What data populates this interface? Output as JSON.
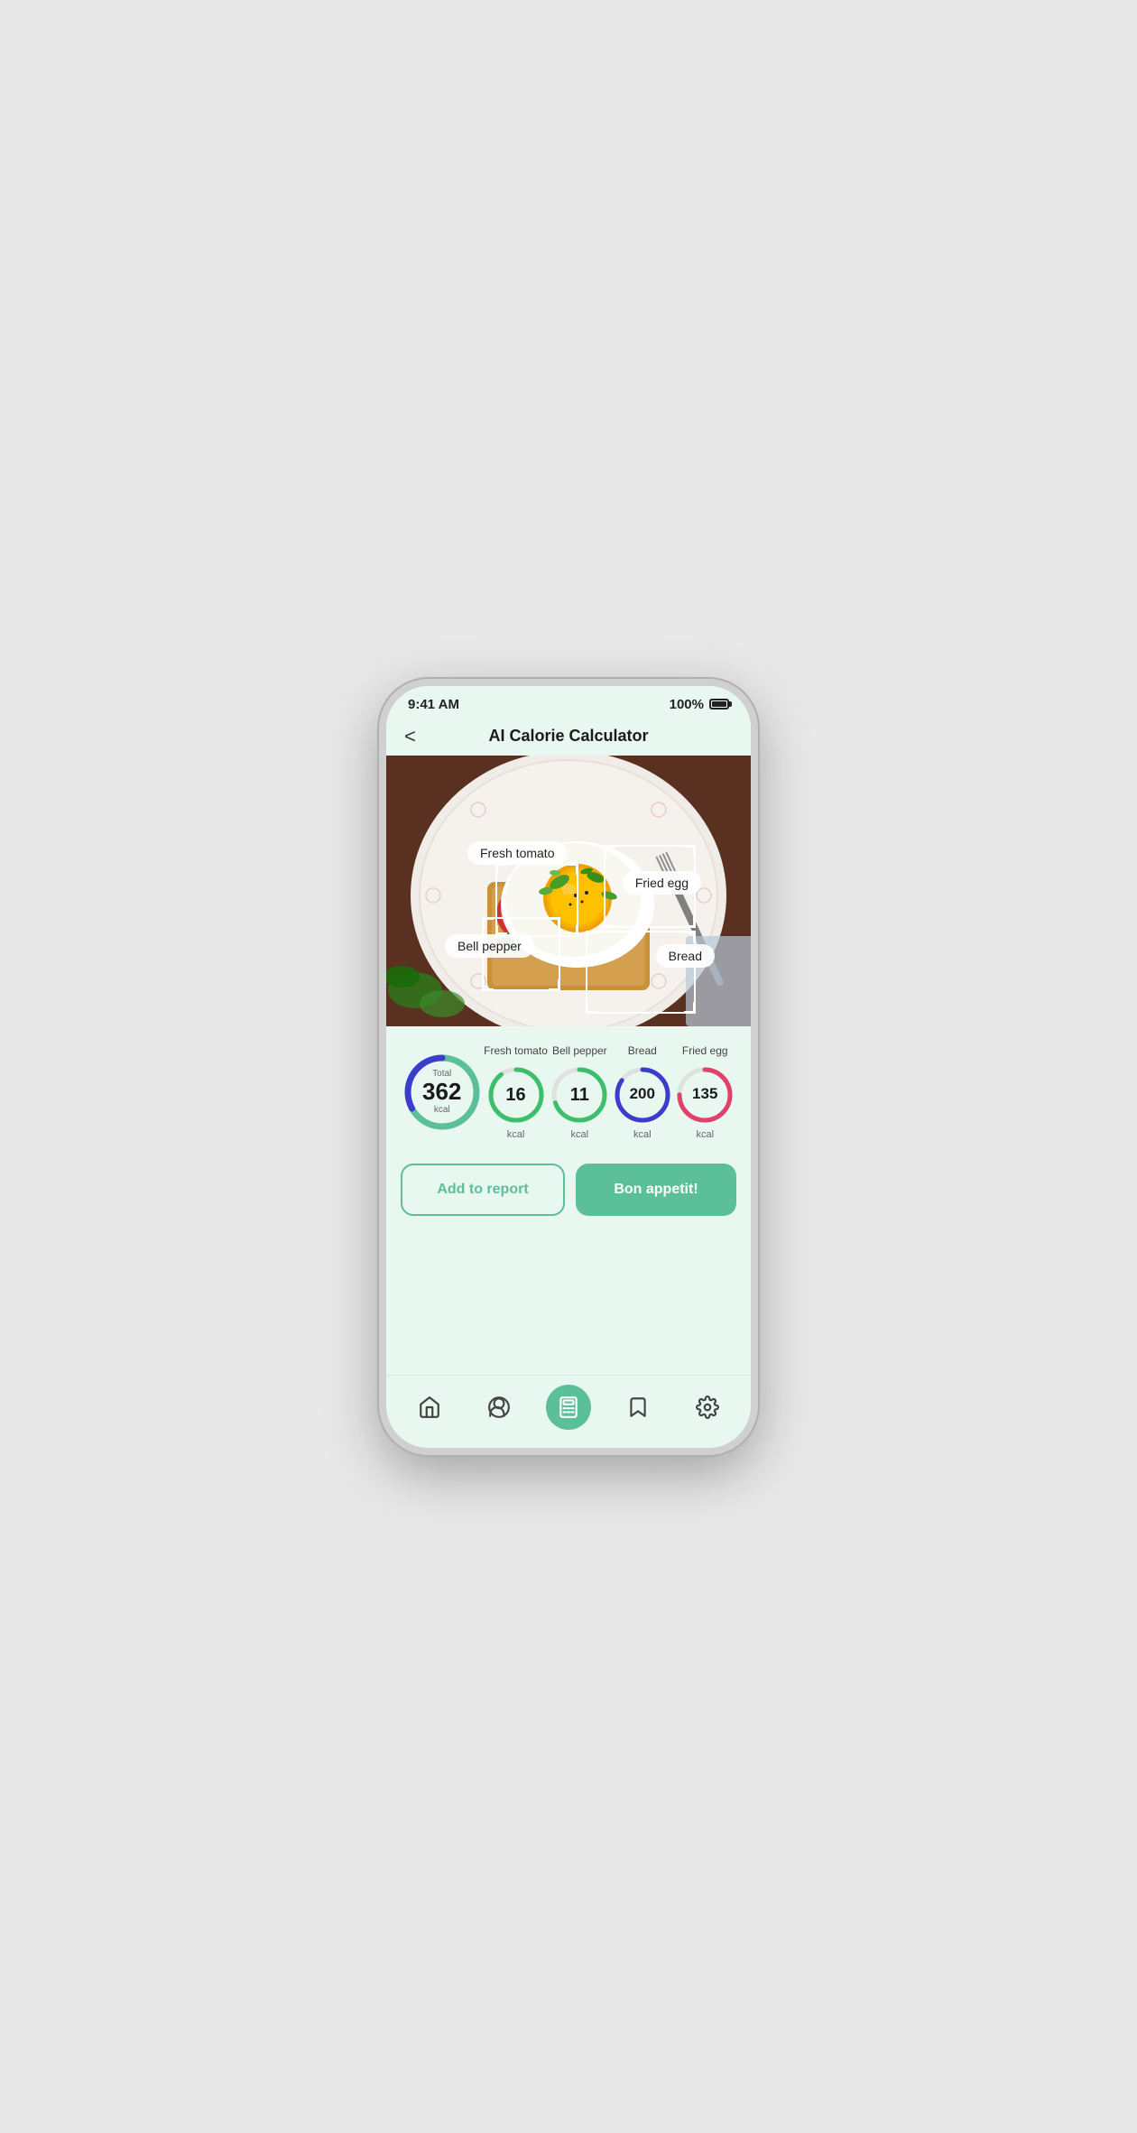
{
  "status_bar": {
    "time": "9:41 AM",
    "battery": "100%"
  },
  "header": {
    "title": "AI Calorie Calculator",
    "back_label": "<"
  },
  "food_labels": [
    {
      "id": "fresh-tomato",
      "text": "Fresh tomato"
    },
    {
      "id": "fried-egg",
      "text": "Fried egg"
    },
    {
      "id": "bell-pepper",
      "text": "Bell pepper"
    },
    {
      "id": "bread",
      "text": "Bread"
    }
  ],
  "calories": {
    "total": {
      "label": "Total",
      "value": "362",
      "unit": "kcal",
      "ring_color_1": "#3b3bcc",
      "ring_color_2": "#5bbf9a"
    },
    "items": [
      {
        "name": "Fresh tomato",
        "value": "16",
        "unit": "kcal",
        "color": "#3cbf6a",
        "percent": 90
      },
      {
        "name": "Bell pepper",
        "value": "11",
        "unit": "kcal",
        "color": "#3cbf6a",
        "percent": 70
      },
      {
        "name": "Bread",
        "value": "200",
        "unit": "kcal",
        "color": "#3b3bcc",
        "percent": 85
      },
      {
        "name": "Fried egg",
        "value": "135",
        "unit": "kcal",
        "color": "#e0406a",
        "percent": 75
      }
    ]
  },
  "buttons": {
    "add_to_report": "Add to report",
    "bon_appetit": "Bon appetit!"
  },
  "nav": {
    "items": [
      {
        "id": "home",
        "icon": "🏠",
        "label": "Home",
        "active": false
      },
      {
        "id": "profile",
        "icon": "👤",
        "label": "Profile",
        "active": false
      },
      {
        "id": "calculator",
        "icon": "🔢",
        "label": "Calculator",
        "active": true
      },
      {
        "id": "bookmark",
        "icon": "🔖",
        "label": "Bookmark",
        "active": false
      },
      {
        "id": "settings",
        "icon": "⚙️",
        "label": "Settings",
        "active": false
      }
    ]
  }
}
